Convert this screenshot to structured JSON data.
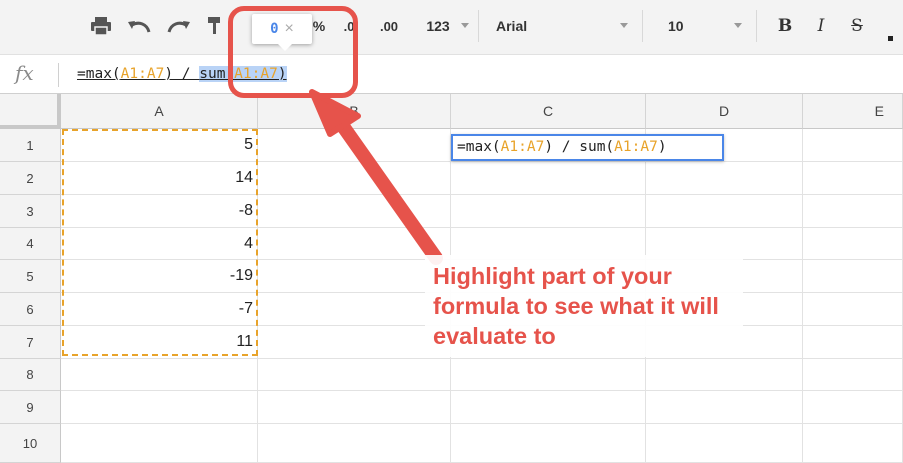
{
  "toolbar": {
    "print_icon": "print-icon",
    "undo_icon": "undo-icon",
    "redo_icon": "redo-icon",
    "paint_format_icon": "paint-format-icon",
    "percent_label": "%",
    "decrease_decimals_label": ".0",
    "increase_decimals_label": ".00",
    "more_formats_label": "123",
    "font_name": "Arial",
    "font_size": "10",
    "bold_label": "B",
    "italic_label": "I",
    "strike_label": "S"
  },
  "formula_bar": {
    "fx_label": "fx",
    "formula_parts": {
      "p1": "=max(",
      "p2": "A1:A7",
      "p3": ") / ",
      "p4": "sum(",
      "p5": "A1:A7",
      "p6": ")"
    }
  },
  "eval_tooltip": {
    "value": "0",
    "close": "×"
  },
  "grid": {
    "columns": [
      "A",
      "B",
      "C",
      "D",
      "E"
    ],
    "rows": [
      "1",
      "2",
      "3",
      "4",
      "5",
      "6",
      "7",
      "8",
      "9",
      "10"
    ],
    "column_a_values": [
      "5",
      "14",
      "-8",
      "4",
      "-19",
      "-7",
      "11"
    ]
  },
  "cell_editor": {
    "p1": "=max(",
    "p2": "A1:A7",
    "p3": ") / sum(",
    "p4": "A1:A7",
    "p5": ")"
  },
  "annotation": {
    "text": "Highlight part of your formula to see what it will evaluate to"
  },
  "colors": {
    "accent_red": "#e6534b",
    "range_orange": "#e8a32a",
    "selection_blue": "#4a86e8"
  }
}
